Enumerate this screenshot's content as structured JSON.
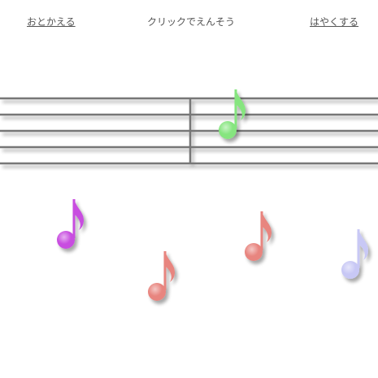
{
  "nav": {
    "left_label": "おとかえる",
    "center_hint": "クリックでえんそう",
    "right_label": "はやくする"
  },
  "notes": [
    {
      "name": "note-green",
      "color": "#86e57f",
      "on_staff": true
    },
    {
      "name": "note-magenta",
      "color": "#c84de0",
      "on_staff": false
    },
    {
      "name": "note-salmon-low",
      "color": "#e8857f",
      "on_staff": false
    },
    {
      "name": "note-salmon-mid",
      "color": "#e8857f",
      "on_staff": false
    },
    {
      "name": "note-lavender",
      "color": "#c8c8f5",
      "on_staff": false
    }
  ],
  "colors": {
    "staff_line": "#777777",
    "text": "#555555"
  }
}
